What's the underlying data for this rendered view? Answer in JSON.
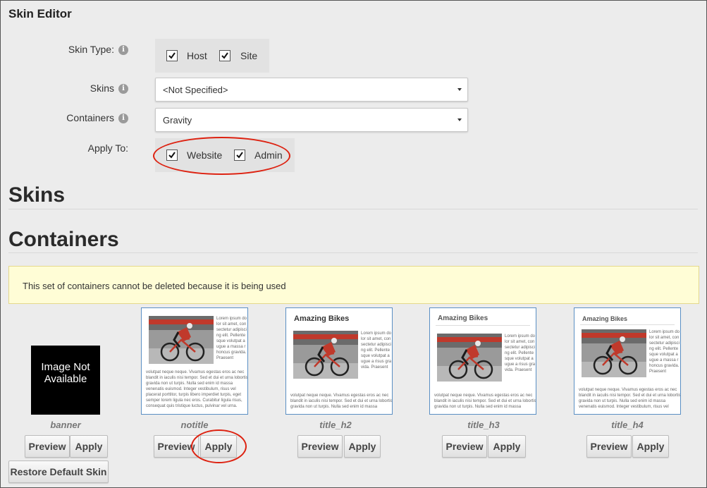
{
  "page": {
    "title": "Skin Editor"
  },
  "form": {
    "skin_type": {
      "label": "Skin Type:",
      "options": [
        {
          "label": "Host",
          "checked": true
        },
        {
          "label": "Site",
          "checked": true
        }
      ]
    },
    "skins": {
      "label": "Skins",
      "value": "<Not Specified>"
    },
    "containers": {
      "label": "Containers",
      "value": "Gravity"
    },
    "apply_to": {
      "label": "Apply To:",
      "options": [
        {
          "label": "Website",
          "checked": true
        },
        {
          "label": "Admin",
          "checked": true
        }
      ]
    }
  },
  "sections": {
    "skins_heading": "Skins",
    "containers_heading": "Containers"
  },
  "notice": {
    "text": "This set of containers cannot be deleted because it is being used"
  },
  "containers_list": [
    {
      "name": "banner",
      "image_placeholder": "Image Not Available",
      "preview_label": "Preview",
      "apply_label": "Apply"
    },
    {
      "name": "notitle",
      "preview_label": "Preview",
      "apply_label": "Apply"
    },
    {
      "name": "title_h2",
      "thumb_title": "Amazing Bikes",
      "preview_label": "Preview",
      "apply_label": "Apply"
    },
    {
      "name": "title_h3",
      "thumb_title": "Amazing Bikes",
      "preview_label": "Preview",
      "apply_label": "Apply"
    },
    {
      "name": "title_h4",
      "thumb_title": "Amazing Bikes",
      "preview_label": "Preview",
      "apply_label": "Apply"
    }
  ],
  "thumb_text": {
    "col": "Lorem ipsum dolor sit amet, consectetur adipiscing elit. Pellentesque volutpat augue a massa rhoncus gravida. Praesent",
    "col_short": "Lorem ipsum dolor sit amet, consectetur adipiscing elit. Pellentesque volutpat augue a risus gravida. Praesent",
    "row1": "volutpat neque neque. Vivamus egestas eros ac nec",
    "row2": "blandit in iaculis nisi tempor. Sed et dui et urna lobortis",
    "row3": "gravida non ut turpis. Nulla sed enim id massa",
    "row4": "venenatis euismod. Integer vestibulum, risus vel",
    "row5": "placerat porttitor, turpis libero imperdiet turpis, eget",
    "row6": "semper lorem ligula nec eros. Curabitur ligula risus,",
    "row7": "consequat quis tristique luctus, pulvinar vel urna."
  },
  "footer": {
    "restore_label": "Restore Default Skin"
  },
  "colors": {
    "annotation": "#d21",
    "thumb_border": "#5a8fc4",
    "notice_bg": "#fffdd6"
  },
  "icons": {
    "info": "info-icon",
    "check": "check-icon",
    "caret": "caret-down-icon"
  }
}
